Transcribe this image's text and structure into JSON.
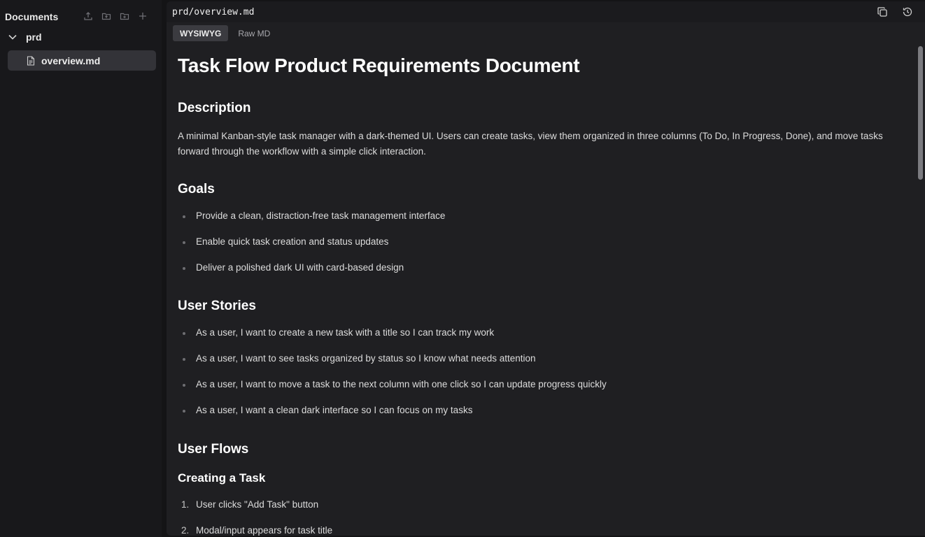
{
  "sidebar": {
    "title": "Documents",
    "actions": [
      {
        "icon": "upload-icon"
      },
      {
        "icon": "folder-upload-icon"
      },
      {
        "icon": "new-folder-icon"
      },
      {
        "icon": "plus-icon"
      }
    ],
    "folder": {
      "label": "prd",
      "expanded": true
    },
    "file": {
      "label": "overview.md",
      "selected": true
    }
  },
  "topbar": {
    "path": "prd/overview.md",
    "icons": [
      "copy-icon",
      "history-icon"
    ]
  },
  "tabs": [
    {
      "label": "WYSIWYG",
      "active": true
    },
    {
      "label": "Raw MD",
      "active": false
    }
  ],
  "document": {
    "title": "Task Flow Product Requirements Document",
    "description_heading": "Description",
    "description": "A minimal Kanban-style task manager with a dark-themed UI. Users can create tasks, view them organized in three columns (To Do, In Progress, Done), and move tasks forward through the workflow with a simple click interaction.",
    "goals_heading": "Goals",
    "goals": [
      "Provide a clean, distraction-free task management interface",
      "Enable quick task creation and status updates",
      "Deliver a polished dark UI with card-based design"
    ],
    "stories_heading": "User Stories",
    "stories": [
      "As a user, I want to create a new task with a title so I can track my work",
      "As a user, I want to see tasks organized by status so I know what needs attention",
      "As a user, I want to move a task to the next column with one click so I can update progress quickly",
      "As a user, I want a clean dark interface so I can focus on my tasks"
    ],
    "flows_heading": "User Flows",
    "flow_creating_heading": "Creating a Task",
    "flow_creating_steps": [
      {
        "n": "1.",
        "text": "User clicks \"Add Task\" button"
      },
      {
        "n": "2.",
        "text": "Modal/input appears for task title"
      }
    ]
  },
  "colors": {
    "sidebar_bg": "#18181b",
    "main_bg": "#1f1f22",
    "selected_bg": "#333338",
    "active_tab_bg": "#3b3b40"
  }
}
